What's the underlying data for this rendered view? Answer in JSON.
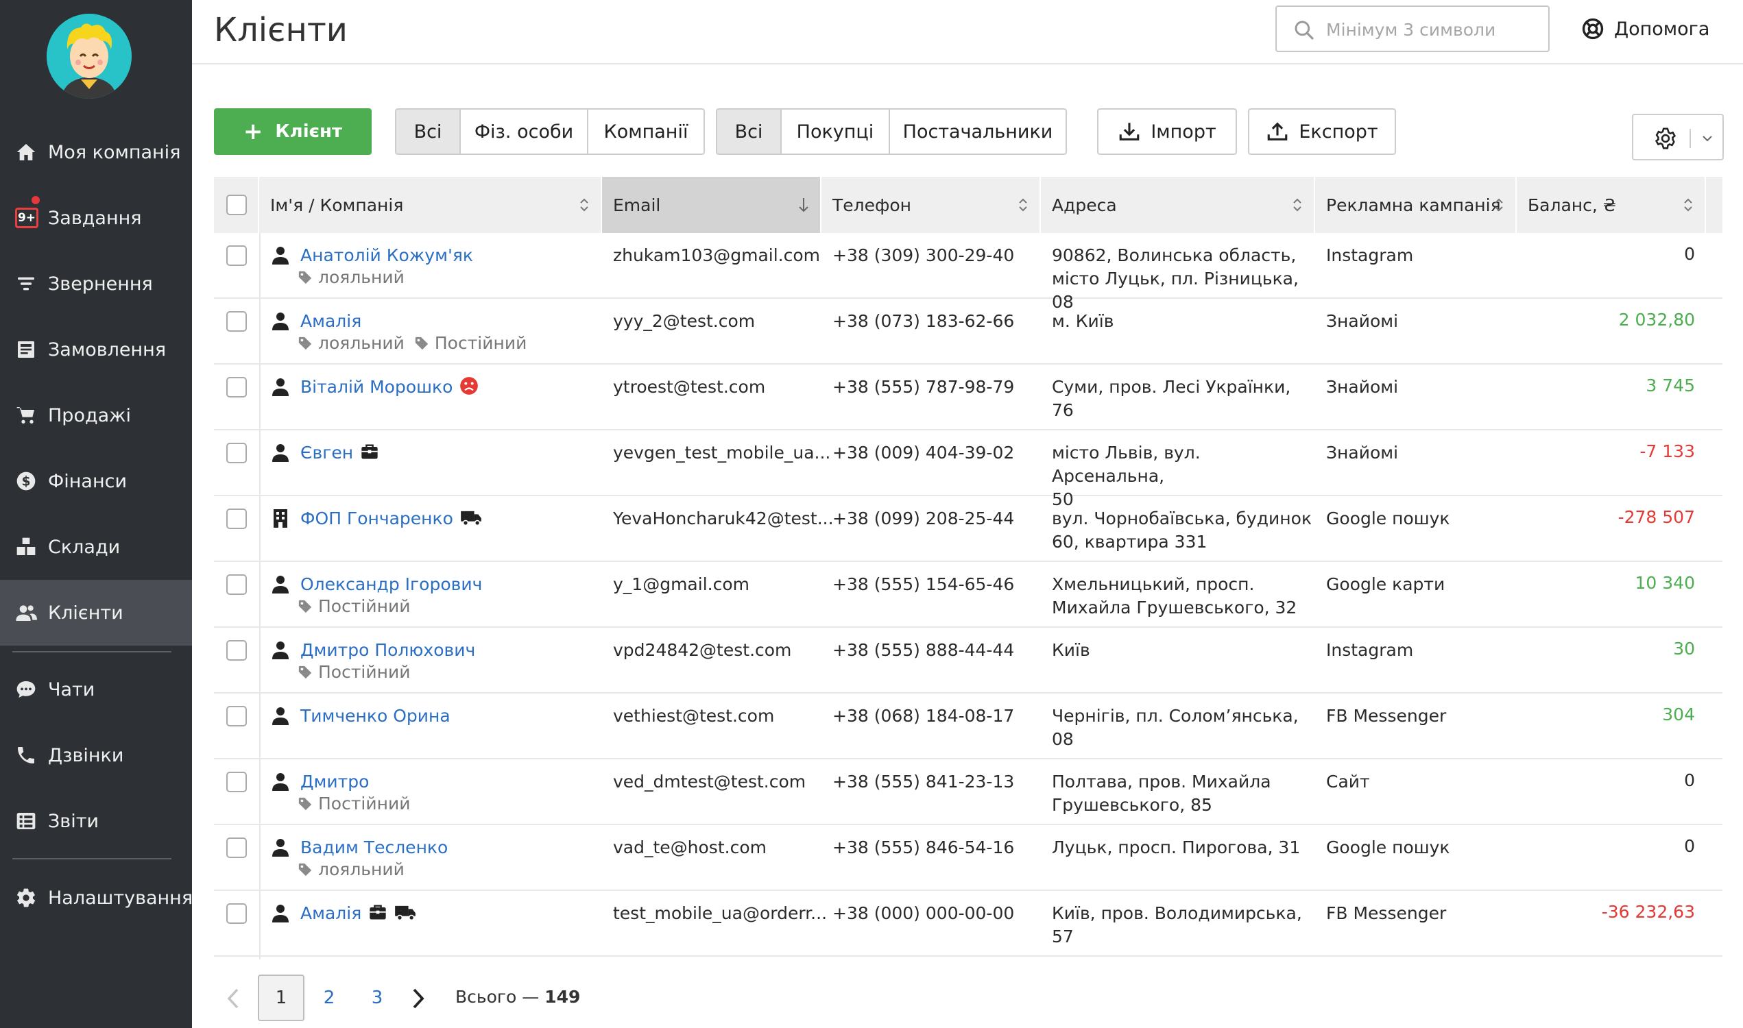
{
  "page": {
    "title": "Клієнти"
  },
  "search": {
    "placeholder": "Мінімум 3 символи"
  },
  "help": {
    "label": "Допомога"
  },
  "sidebar": {
    "task_badge": "9+",
    "items": [
      {
        "label": "Моя компанія",
        "icon": "home-icon"
      },
      {
        "label": "Завдання",
        "icon": "tasks-icon"
      },
      {
        "label": "Звернення",
        "icon": "filter-icon"
      },
      {
        "label": "Замовлення",
        "icon": "orders-icon"
      },
      {
        "label": "Продажі",
        "icon": "cart-icon"
      },
      {
        "label": "Фінанси",
        "icon": "dollar-icon"
      },
      {
        "label": "Склади",
        "icon": "boxes-icon"
      },
      {
        "label": "Клієнти",
        "icon": "users-icon",
        "active": true
      },
      {
        "label": "Чати",
        "icon": "chat-icon"
      },
      {
        "label": "Дзвінки",
        "icon": "phone-icon"
      },
      {
        "label": "Звіти",
        "icon": "reports-icon"
      },
      {
        "label": "Налаштування",
        "icon": "gear-icon"
      }
    ]
  },
  "toolbar": {
    "add_label": "Клієнт",
    "type_filter": [
      "Всі",
      "Фіз. особи",
      "Компанії"
    ],
    "role_filter": [
      "Всі",
      "Покупці",
      "Постачальники"
    ],
    "import_label": "Імпорт",
    "export_label": "Експорт"
  },
  "table": {
    "columns": [
      "Ім'я / Компанія",
      "Email",
      "Телефон",
      "Адреса",
      "Рекламна кампанія",
      "Баланс, ₴"
    ],
    "sorted_column": "Email",
    "rows": [
      {
        "name": "Анатолій Кожум'як",
        "kind": "person",
        "tags": [
          "лояльний"
        ],
        "icons": [],
        "email": "zhukam103@gmail.com",
        "phone": "+38 (309) 300-29-40",
        "address1": "90862, Волинська область,",
        "address2": "місто Луцьк, пл. Різницька, 08",
        "campaign": "Instagram",
        "balance": "0",
        "balance_sign": "zero"
      },
      {
        "name": "Амалія",
        "kind": "person",
        "tags": [
          "лояльний",
          "Постійний"
        ],
        "icons": [],
        "email": "yyy_2@test.com",
        "phone": "+38 (073) 183-62-66",
        "address1": "м. Київ",
        "address2": "",
        "campaign": "Знайомі",
        "balance": "2 032,80",
        "balance_sign": "pos"
      },
      {
        "name": "Віталій Морошко",
        "kind": "person",
        "tags": [],
        "icons": [
          "sad-face-icon"
        ],
        "email": "ytroest@test.com",
        "phone": "+38 (555) 787-98-79",
        "address1": "Суми, пров. Лесі Українки, 76",
        "address2": "",
        "campaign": "Знайомі",
        "balance": "3 745",
        "balance_sign": "pos"
      },
      {
        "name": "Євген",
        "kind": "person",
        "tags": [],
        "icons": [
          "briefcase-icon"
        ],
        "email": "yevgen_test_mobile_ua...",
        "phone": "+38 (009) 404-39-02",
        "address1": "місто Львів, вул. Арсенальна,",
        "address2": "50",
        "campaign": "Знайомі",
        "balance": "-7 133",
        "balance_sign": "neg"
      },
      {
        "name": "ФОП Гончаренко",
        "kind": "company",
        "tags": [],
        "icons": [
          "truck-icon"
        ],
        "email": "YevaHoncharuk42@test...",
        "phone": "+38 (099) 208-25-44",
        "address1": "вул. Чорнобаївська, будинок",
        "address2": "60, квартира 331",
        "campaign": "Google пошук",
        "balance": "-278 507",
        "balance_sign": "neg"
      },
      {
        "name": "Олександр Ігорович",
        "kind": "person",
        "tags": [
          "Постійний"
        ],
        "icons": [],
        "email": "y_1@gmail.com",
        "phone": "+38 (555) 154-65-46",
        "address1": "Хмельницький, просп.",
        "address2": "Михайла Грушевського, 32",
        "campaign": "Google карти",
        "balance": "10 340",
        "balance_sign": "pos"
      },
      {
        "name": "Дмитро Полюхович",
        "kind": "person",
        "tags": [
          "Постійний"
        ],
        "icons": [],
        "email": "vpd24842@test.com",
        "phone": "+38 (555) 888-44-44",
        "address1": "Київ",
        "address2": "",
        "campaign": "Instagram",
        "balance": "30",
        "balance_sign": "pos"
      },
      {
        "name": "Тимченко Орина",
        "kind": "person",
        "tags": [],
        "icons": [],
        "email": "vethiest@test.com",
        "phone": "+38 (068) 184-08-17",
        "address1": "Чернігів, пл. Солом’янська, 08",
        "address2": "",
        "campaign": "FB Messenger",
        "balance": "304",
        "balance_sign": "pos"
      },
      {
        "name": "Дмитро",
        "kind": "person",
        "tags": [
          "Постійний"
        ],
        "icons": [],
        "email": "ved_dmtest@test.com",
        "phone": "+38 (555) 841-23-13",
        "address1": "Полтава, пров. Михайла",
        "address2": "Грушевського, 85",
        "campaign": "Сайт",
        "balance": "0",
        "balance_sign": "zero"
      },
      {
        "name": "Вадим Тесленко",
        "kind": "person",
        "tags": [
          "лояльний"
        ],
        "icons": [],
        "email": "vad_te@host.com",
        "phone": "+38 (555) 846-54-16",
        "address1": "Луцьк, просп. Пирогова, 31",
        "address2": "",
        "campaign": "Google пошук",
        "balance": "0",
        "balance_sign": "zero"
      },
      {
        "name": "Амалія",
        "kind": "person",
        "tags": [],
        "icons": [
          "briefcase-icon",
          "truck-icon"
        ],
        "email": "test_mobile_ua@orderr...",
        "phone": "+38 (000) 000-00-00",
        "address1": "Київ, пров. Володимирська,",
        "address2": "57",
        "campaign": "FB Messenger",
        "balance": "-36 232,63",
        "balance_sign": "neg"
      }
    ]
  },
  "pagination": {
    "pages": [
      "1",
      "2",
      "3"
    ],
    "current": "1",
    "total_label": "Всього —",
    "total_count": "149"
  },
  "colors": {
    "accent_green": "#4cae50",
    "link_blue": "#2b6fc4",
    "negative_red": "#e53935",
    "sidebar_bg": "#2d3035"
  }
}
